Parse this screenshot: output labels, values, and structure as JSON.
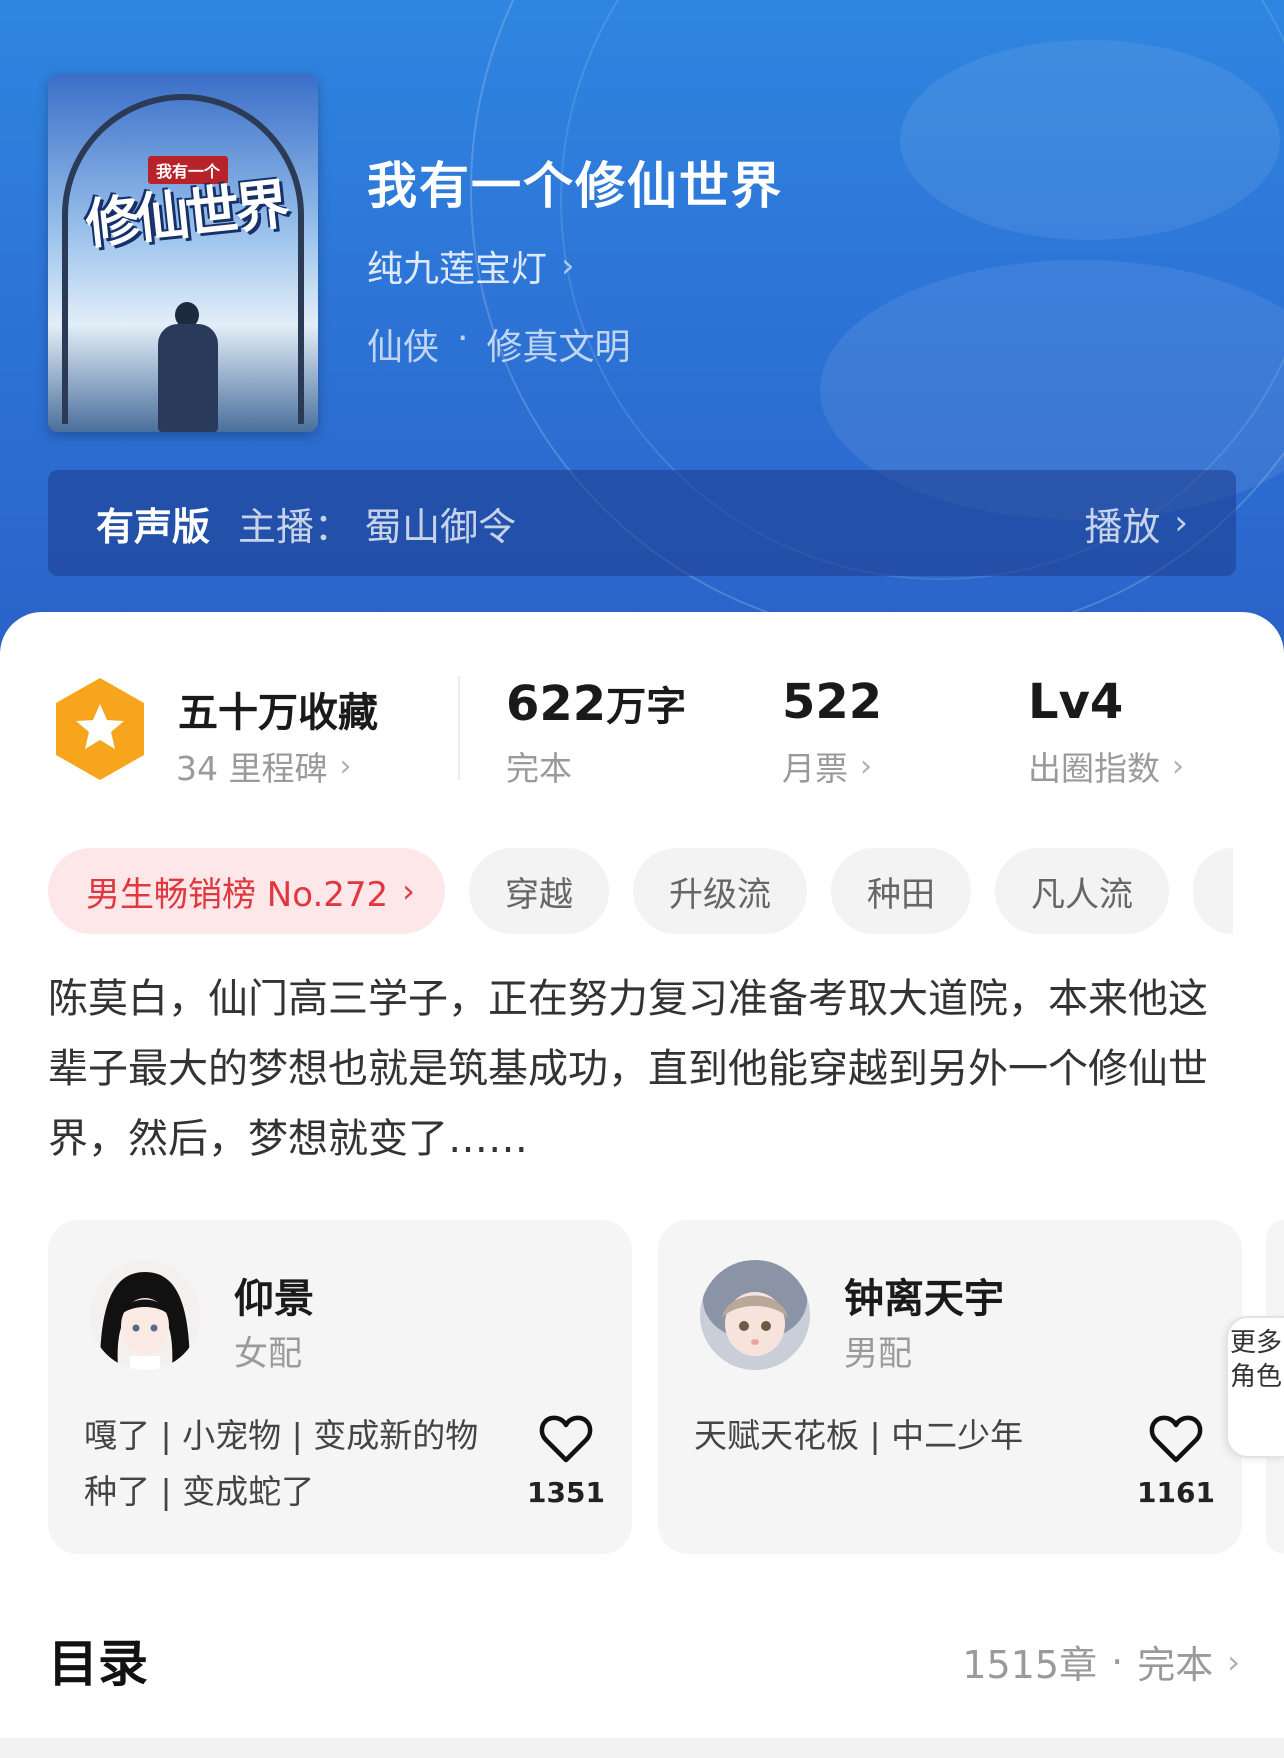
{
  "book": {
    "title": "我有一个修仙世界",
    "author": "纯九莲宝灯",
    "genre": [
      "仙侠",
      "·",
      "修真文明"
    ],
    "cover_title": "修仙世界",
    "cover_sub": "我有一个"
  },
  "audio": {
    "label": "有声版",
    "host": "主播：  蜀山御令",
    "play": "播放"
  },
  "stats": {
    "collect_title": "五十万收藏",
    "collect_sub": "34 里程碑",
    "words_num": "622",
    "words_unit": "万字",
    "words_sub": "完本",
    "tickets_num": "522",
    "tickets_sub": "月票",
    "level_num": "Lv4",
    "level_sub": "出圈指数"
  },
  "tags": {
    "rank": "男生畅销榜 No.272",
    "items": [
      "穿越",
      "升级流",
      "种田",
      "凡人流"
    ]
  },
  "description": "陈莫白，仙门高三学子，正在努力复习准备考取大道院，本来他这辈子最大的梦想也就是筑基成功，直到他能穿越到另外一个修仙世界，然后，梦想就变了……",
  "characters": [
    {
      "name": "仰景",
      "role": "女配",
      "traits": "嘎了 | 小宠物 | 变成新的物种了 | 变成蛇了",
      "likes": "1351"
    },
    {
      "name": "钟离天宇",
      "role": "男配",
      "traits": "天赋天花板 | 中二少年",
      "likes": "1161"
    }
  ],
  "more_roles": "更多角色",
  "toc": {
    "title": "目录",
    "chapters": "1515章",
    "dot": "·",
    "status": "完本"
  },
  "icons": {
    "chevron": "chevron-right-icon",
    "heart": "heart-icon",
    "badge": "star-hexagon-icon"
  },
  "colors": {
    "hero": "#2d76d8",
    "badge": "#f7a51c",
    "rank": "#e0383e"
  }
}
